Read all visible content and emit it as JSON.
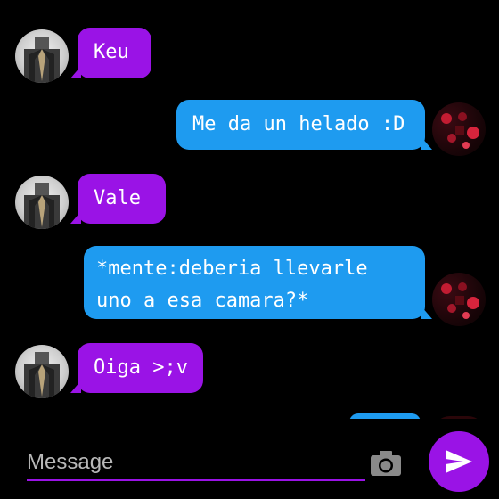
{
  "messages": [
    {
      "sender": "other",
      "text": "Keu"
    },
    {
      "sender": "me",
      "text": "Me da un helado :D"
    },
    {
      "sender": "other",
      "text": "Vale"
    },
    {
      "sender": "me",
      "text": "*mente:deberia llevarle\nuno a esa camara?*"
    },
    {
      "sender": "other",
      "text": "Oiga >;v"
    }
  ],
  "composer": {
    "placeholder": "Message"
  },
  "icons": {
    "camera": "camera-icon",
    "send": "send-icon"
  },
  "colors": {
    "background": "#000000",
    "incoming_bubble": "#9a13e6",
    "outgoing_bubble": "#1e9bf0",
    "accent": "#9a13e6",
    "text": "#ffffff"
  }
}
